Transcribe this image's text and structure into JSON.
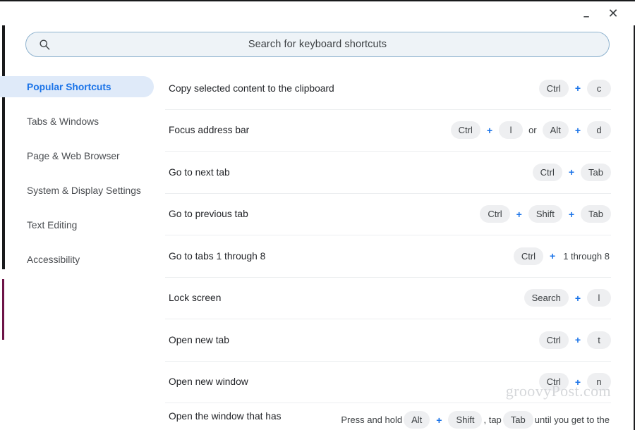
{
  "window": {
    "minimize_label": "–",
    "close_label": "✕"
  },
  "search": {
    "icon": "search-icon",
    "placeholder": "Search for keyboard shortcuts",
    "value": ""
  },
  "sidebar": {
    "items": [
      {
        "label": "Popular Shortcuts",
        "active": true
      },
      {
        "label": "Tabs & Windows",
        "active": false
      },
      {
        "label": "Page & Web Browser",
        "active": false
      },
      {
        "label": "System & Display Settings",
        "active": false
      },
      {
        "label": "Text Editing",
        "active": false
      },
      {
        "label": "Accessibility",
        "active": false
      }
    ]
  },
  "shortcuts": [
    {
      "label": "Copy selected content to the clipboard",
      "keys": [
        {
          "type": "key",
          "text": "Ctrl"
        },
        {
          "type": "plus",
          "text": "+"
        },
        {
          "type": "key",
          "text": "c"
        }
      ]
    },
    {
      "label": "Focus address bar",
      "keys": [
        {
          "type": "key",
          "text": "Ctrl"
        },
        {
          "type": "plus",
          "text": "+"
        },
        {
          "type": "key",
          "text": "l"
        },
        {
          "type": "sep",
          "text": "or"
        },
        {
          "type": "key",
          "text": "Alt"
        },
        {
          "type": "plus",
          "text": "+"
        },
        {
          "type": "key",
          "text": "d"
        }
      ]
    },
    {
      "label": "Go to next tab",
      "keys": [
        {
          "type": "key",
          "text": "Ctrl"
        },
        {
          "type": "plus",
          "text": "+"
        },
        {
          "type": "key",
          "text": "Tab"
        }
      ]
    },
    {
      "label": "Go to previous tab",
      "keys": [
        {
          "type": "key",
          "text": "Ctrl"
        },
        {
          "type": "plus",
          "text": "+"
        },
        {
          "type": "key",
          "text": "Shift"
        },
        {
          "type": "plus",
          "text": "+"
        },
        {
          "type": "key",
          "text": "Tab"
        }
      ]
    },
    {
      "label": "Go to tabs 1 through 8",
      "keys": [
        {
          "type": "key",
          "text": "Ctrl"
        },
        {
          "type": "plus",
          "text": "+"
        },
        {
          "type": "text",
          "text": "1 through 8"
        }
      ]
    },
    {
      "label": "Lock screen",
      "keys": [
        {
          "type": "key",
          "text": "Search"
        },
        {
          "type": "plus",
          "text": "+"
        },
        {
          "type": "key",
          "text": "l"
        }
      ]
    },
    {
      "label": "Open new tab",
      "keys": [
        {
          "type": "key",
          "text": "Ctrl"
        },
        {
          "type": "plus",
          "text": "+"
        },
        {
          "type": "key",
          "text": "t"
        }
      ]
    },
    {
      "label": "Open new window",
      "keys": [
        {
          "type": "key",
          "text": "Ctrl"
        },
        {
          "type": "plus",
          "text": "+"
        },
        {
          "type": "key",
          "text": "n"
        }
      ]
    },
    {
      "label": "Open the window that has",
      "clipped": true,
      "keys": [
        {
          "type": "text",
          "text": "Press and hold"
        },
        {
          "type": "key",
          "text": "Alt"
        },
        {
          "type": "plus",
          "text": "+"
        },
        {
          "type": "key",
          "text": "Shift"
        },
        {
          "type": "text",
          "text": ", tap"
        },
        {
          "type": "key",
          "text": "Tab"
        },
        {
          "type": "text",
          "text": "until you get to the"
        }
      ]
    }
  ],
  "watermark": {
    "text": "groovyPost.com"
  },
  "colors": {
    "accent": "#1a73e8",
    "active_nav_bg": "#dfeaf9",
    "key_chip_bg": "#eeeff1",
    "search_bg": "#eef3f7",
    "search_border": "#8fb3cf",
    "divider": "#eceef0",
    "text": "#222428",
    "muted_text": "#4a4d51",
    "frame_dark": "#18191b",
    "frame_accent": "#6d1447",
    "watermark": "#d5d7da"
  }
}
